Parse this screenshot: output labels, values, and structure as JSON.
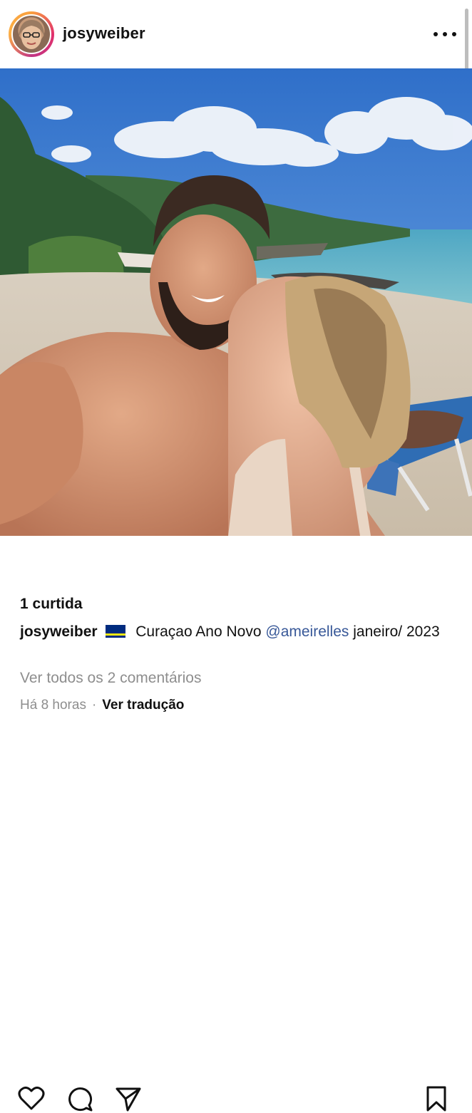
{
  "post": {
    "username": "josyweiber",
    "more_icon": "more-options-icon",
    "likes_text": "1 curtida",
    "caption": {
      "username": "josyweiber",
      "flag_icon": "curacao-flag-icon",
      "text_before_mention": "Curaçao Ano Novo",
      "mention": "@ameirelles",
      "text_after_mention": "janeiro/ 2023"
    },
    "view_comments": "Ver todos os 2 comentários",
    "time_ago": "Há 8 horas",
    "separator": "·",
    "translate_link": "Ver tradução"
  },
  "icons": {
    "like": "heart-icon",
    "comment": "comment-icon",
    "share": "send-icon",
    "save": "bookmark-icon"
  },
  "colors": {
    "mention": "#385898",
    "secondary_text": "#8e8e8e",
    "story_ring": "#e1306c"
  }
}
